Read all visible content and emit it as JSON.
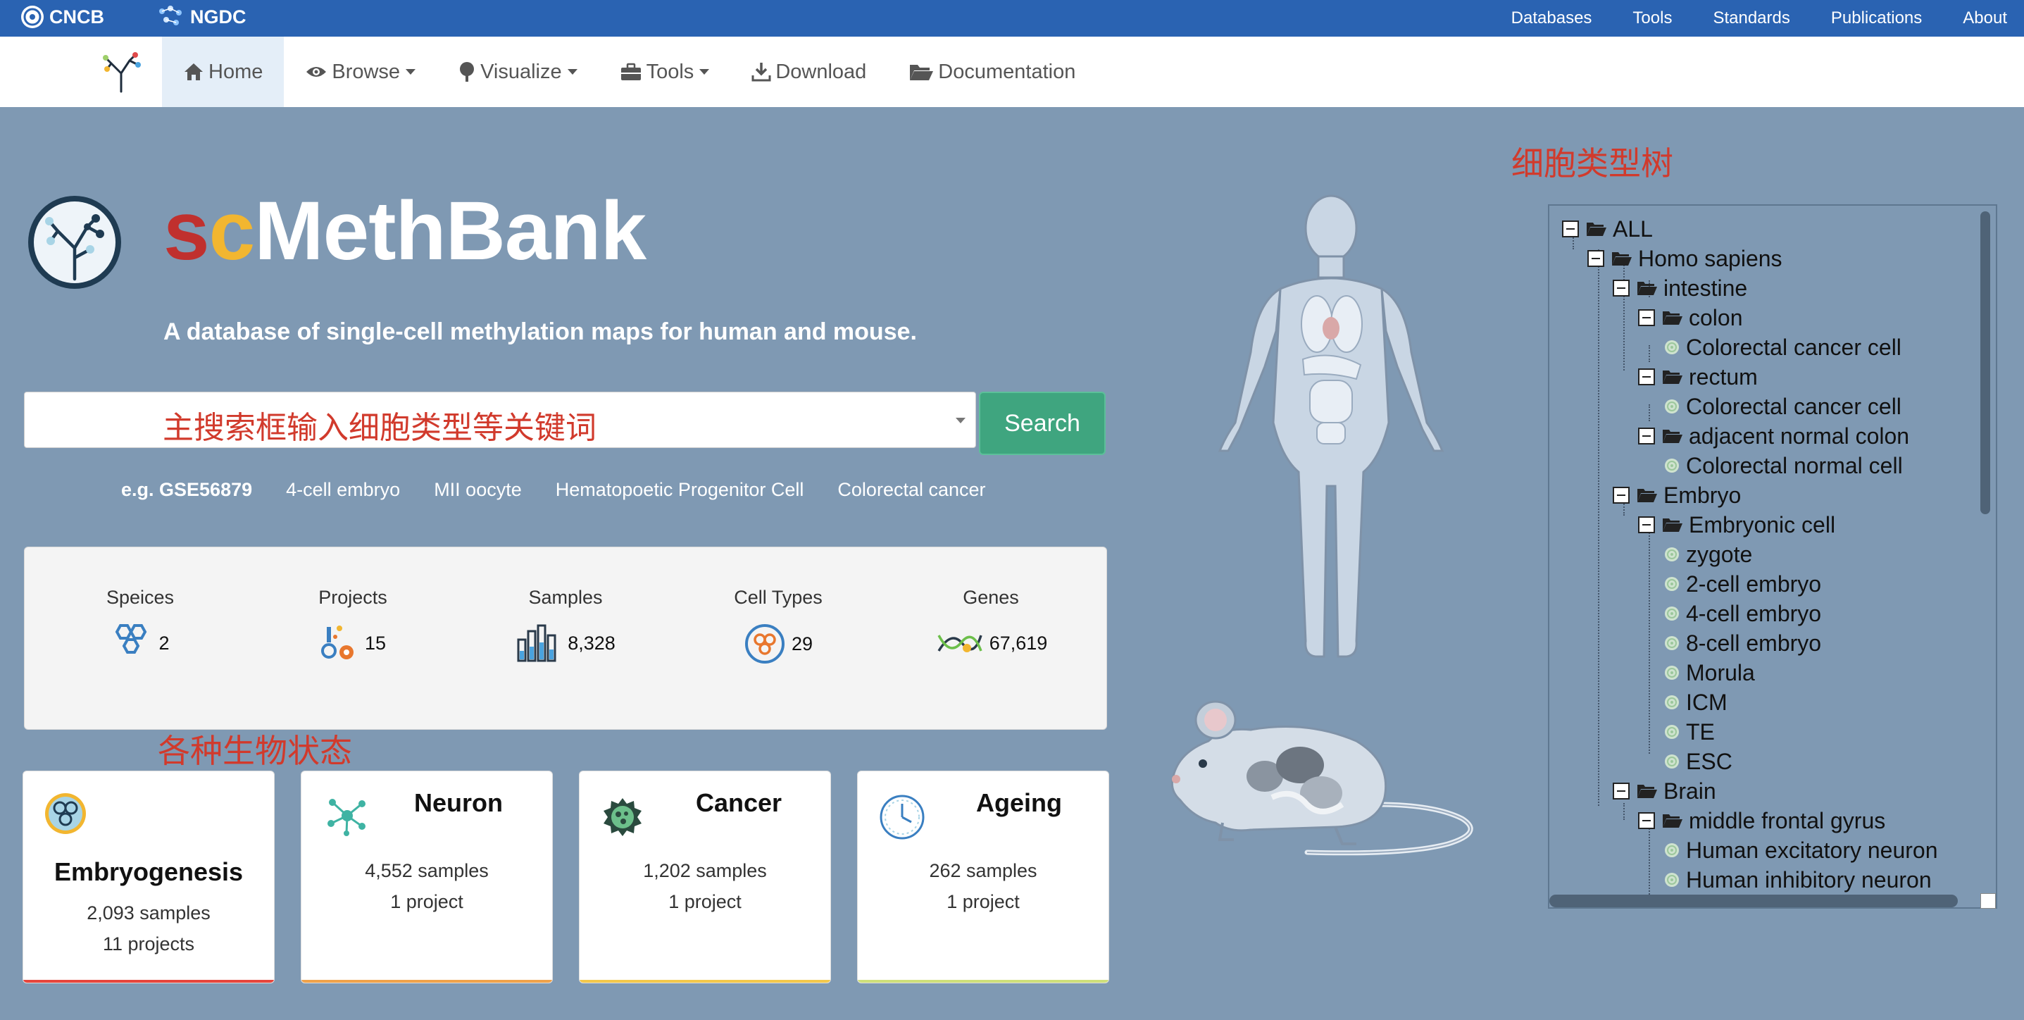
{
  "topbar": {
    "brand_cncb": "CNCB",
    "brand_ngdc": "NGDC",
    "links": [
      "Databases",
      "Tools",
      "Standards",
      "Publications",
      "About"
    ]
  },
  "nav": {
    "home": "Home",
    "browse": "Browse",
    "visualize": "Visualize",
    "tools": "Tools",
    "download": "Download",
    "documentation": "Documentation"
  },
  "hero": {
    "title_s": "s",
    "title_c": "c",
    "title_rest": "MethBank",
    "subtitle": "A database of single-cell methylation maps for human and mouse."
  },
  "search": {
    "placeholder": "主搜索框输入细胞类型等关键词",
    "button": "Search"
  },
  "examples": {
    "lead": "e.g. GSE56879",
    "items": [
      "4-cell embryo",
      "MII oocyte",
      "Hematopoetic Progenitor Cell",
      "Colorectal cancer"
    ]
  },
  "stats": [
    {
      "label": "Speices",
      "value": "2"
    },
    {
      "label": "Projects",
      "value": "15"
    },
    {
      "label": "Samples",
      "value": "8,328"
    },
    {
      "label": "Cell Types",
      "value": "29"
    },
    {
      "label": "Genes",
      "value": "67,619"
    }
  ],
  "annotations": {
    "states": "各种生物状态",
    "tree": "细胞类型树"
  },
  "cards": [
    {
      "title": "Embryogenesis",
      "samples": "2,093 samples",
      "projects": "11 projects",
      "accent": "#e8453c"
    },
    {
      "title": "Neuron",
      "samples": "4,552 samples",
      "projects": "1 project",
      "accent": "#f0a24a"
    },
    {
      "title": "Cancer",
      "samples": "1,202 samples",
      "projects": "1 project",
      "accent": "#f3c84b"
    },
    {
      "title": "Ageing",
      "samples": "262 samples",
      "projects": "1 project",
      "accent": "#cfe07a"
    }
  ],
  "tree": {
    "nodes": [
      {
        "label": "ALL",
        "type": "folder"
      },
      {
        "label": "Homo sapiens",
        "type": "folder"
      },
      {
        "label": "intestine",
        "type": "folder"
      },
      {
        "label": "colon",
        "type": "folder"
      },
      {
        "label": "Colorectal cancer cell",
        "type": "leaf"
      },
      {
        "label": "rectum",
        "type": "folder"
      },
      {
        "label": "Colorectal cancer cell",
        "type": "leaf"
      },
      {
        "label": "adjacent normal colon",
        "type": "folder"
      },
      {
        "label": "Colorectal normal cell",
        "type": "leaf"
      },
      {
        "label": "Embryo",
        "type": "folder"
      },
      {
        "label": "Embryonic cell",
        "type": "folder"
      },
      {
        "label": "zygote",
        "type": "leaf"
      },
      {
        "label": "2-cell embryo",
        "type": "leaf"
      },
      {
        "label": "4-cell embryo",
        "type": "leaf"
      },
      {
        "label": "8-cell embryo",
        "type": "leaf"
      },
      {
        "label": "Morula",
        "type": "leaf"
      },
      {
        "label": "ICM",
        "type": "leaf"
      },
      {
        "label": "TE",
        "type": "leaf"
      },
      {
        "label": "ESC",
        "type": "leaf"
      },
      {
        "label": "Brain",
        "type": "folder"
      },
      {
        "label": "middle frontal gyrus",
        "type": "folder"
      },
      {
        "label": "Human excitatory neuron",
        "type": "leaf"
      },
      {
        "label": "Human inhibitory neuron",
        "type": "leaf"
      }
    ]
  },
  "colors": {
    "topbar": "#2a63b2",
    "background": "#7f99b3",
    "search_button": "#3fa57f",
    "annotation": "#d13a2c"
  }
}
